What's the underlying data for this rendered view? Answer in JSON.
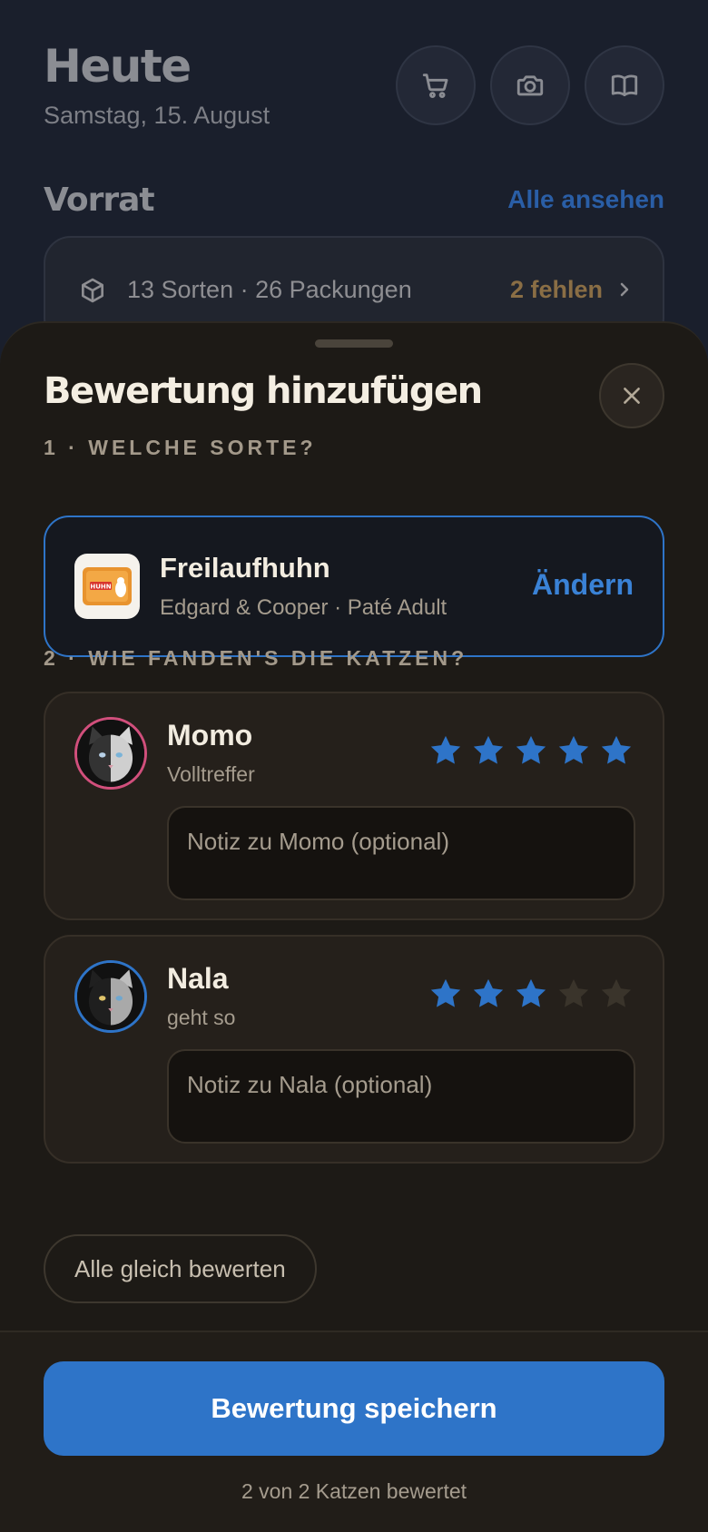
{
  "background": {
    "title": "Heute",
    "date": "Samstag, 15. August",
    "header_icons": [
      "cart-icon",
      "camera-icon",
      "book-icon"
    ],
    "section_title": "Vorrat",
    "section_link": "Alle ansehen",
    "stock_summary": "13 Sorten · 26 Packungen",
    "stock_missing": "2 fehlen"
  },
  "sheet": {
    "title": "Bewertung hinzufügen",
    "step1_label": "1 · WELCHE SORTE?",
    "product": {
      "name": "Freilaufhuhn",
      "subtitle": "Edgard & Cooper · Paté Adult",
      "thumb_text": "HUHN",
      "change_label": "Ändern"
    },
    "step2_label": "2 · WIE FANDEN'S DIE KATZEN?",
    "cats": [
      {
        "name": "Momo",
        "verdict": "Volltreffer",
        "rating": 5,
        "max": 5,
        "note_placeholder": "Notiz zu Momo (optional)",
        "ring_color": "#d14f7c"
      },
      {
        "name": "Nala",
        "verdict": "geht so",
        "rating": 3,
        "max": 5,
        "note_placeholder": "Notiz zu Nala (optional)",
        "ring_color": "#2e74c8"
      }
    ],
    "same_rating_label": "Alle gleich bewerten",
    "save_label": "Bewertung speichern",
    "status": "2 von 2 Katzen bewertet"
  },
  "colors": {
    "accent": "#2e74c8",
    "star_on": "#2e74c8",
    "star_off": "#3a342b",
    "warning": "#8a6e45"
  }
}
